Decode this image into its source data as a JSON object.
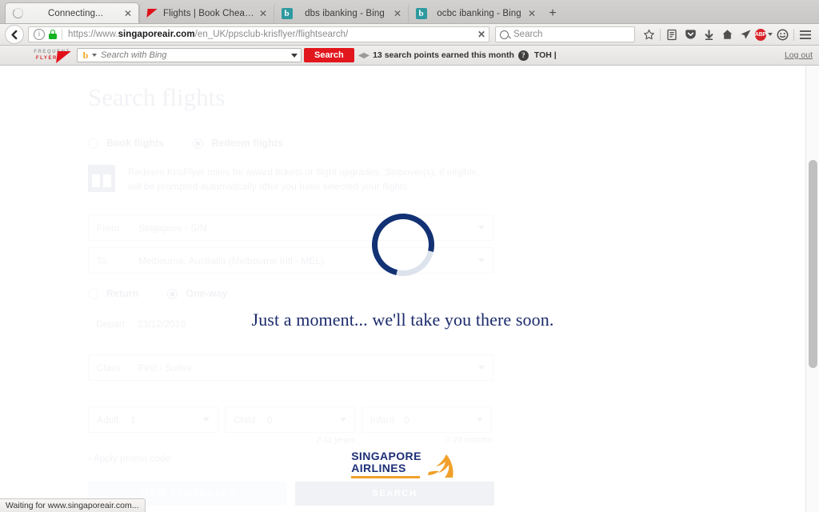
{
  "browser": {
    "tabs": [
      {
        "title": "Connecting...",
        "favicon": "spinner-icon",
        "active": true,
        "close_label": "✕"
      },
      {
        "title": "Flights | Book Cheap Flight...",
        "favicon": "qantas-icon",
        "active": false,
        "close_label": "✕"
      },
      {
        "title": "dbs ibanking - Bing",
        "favicon": "bing-icon",
        "active": false,
        "close_label": "✕"
      },
      {
        "title": "ocbc ibanking - Bing",
        "favicon": "bing-icon",
        "active": false,
        "close_label": "✕"
      }
    ],
    "new_tab_label": "+",
    "address": {
      "url_prefix": "https://www.",
      "url_domain": "singaporeair.com",
      "url_suffix": "/en_UK/ppsclub-krisflyer/flightsearch/",
      "clear_label": "✕"
    },
    "search": {
      "placeholder": "Search"
    },
    "toolbar_icons": [
      "bookmark-star-icon",
      "reader-library-icon",
      "pocket-icon",
      "downloads-icon",
      "home-icon",
      "send-tab-icon",
      "adblock-plus-icon",
      "smiley-feedback-icon",
      "hamburger-menu-icon"
    ],
    "adblock_label": "ABP",
    "status_text": "Waiting for www.singaporeair.com..."
  },
  "qantas_toolbar": {
    "logo_line1": "FREQUENT",
    "logo_line2": "FLYER",
    "bing_placeholder": "Search with Bing",
    "search_button": "Search",
    "points_text": "13 search points earned this month",
    "help_label": "?",
    "user": "TOH |",
    "logout": "Log out"
  },
  "page": {
    "title": "Search flights",
    "tabs": [
      {
        "label": "Book flights",
        "selected": false
      },
      {
        "label": "Redeem flights",
        "selected": true
      }
    ],
    "notice": "Redeem KrisFlyer miles for award tickets or flight upgrades. Stopover(s), if eligible, will be prompted automatically after you have selected your flights.",
    "fields": {
      "from": {
        "label": "From",
        "value": "Singapore - SIN"
      },
      "to": {
        "label": "To",
        "value": "Melbourne, Australia (Melbourne Intl - MEL)"
      },
      "trip": [
        {
          "label": "Return",
          "selected": false
        },
        {
          "label": "One-way",
          "selected": true
        }
      ],
      "depart": {
        "label": "Depart",
        "value": "23/12/2016"
      },
      "class": {
        "label": "Class",
        "value": "First / Suites"
      },
      "adult": {
        "label": "Adult",
        "value": "1",
        "hint": ""
      },
      "child": {
        "label": "Child",
        "value": "0",
        "hint": "2-11 years"
      },
      "infant": {
        "label": "Infant",
        "value": "0",
        "hint": "0-23 months"
      }
    },
    "promo_label": "Apply promo code",
    "buttons": {
      "view_schedules": "VIEW SCHEDULES",
      "search": "SEARCH"
    }
  },
  "overlay": {
    "message": "Just a moment... we'll take you there soon.",
    "spinner_name": "loading-spinner",
    "logo": {
      "line1": "SINGAPORE",
      "line2": "AIRLINES"
    }
  },
  "colors": {
    "sia_navy": "#1b2a6b",
    "spinner_arc": "#123274",
    "spinner_track": "#dde3ec",
    "qantas_red": "#e2171e",
    "sia_gold": "#f0a02a"
  }
}
